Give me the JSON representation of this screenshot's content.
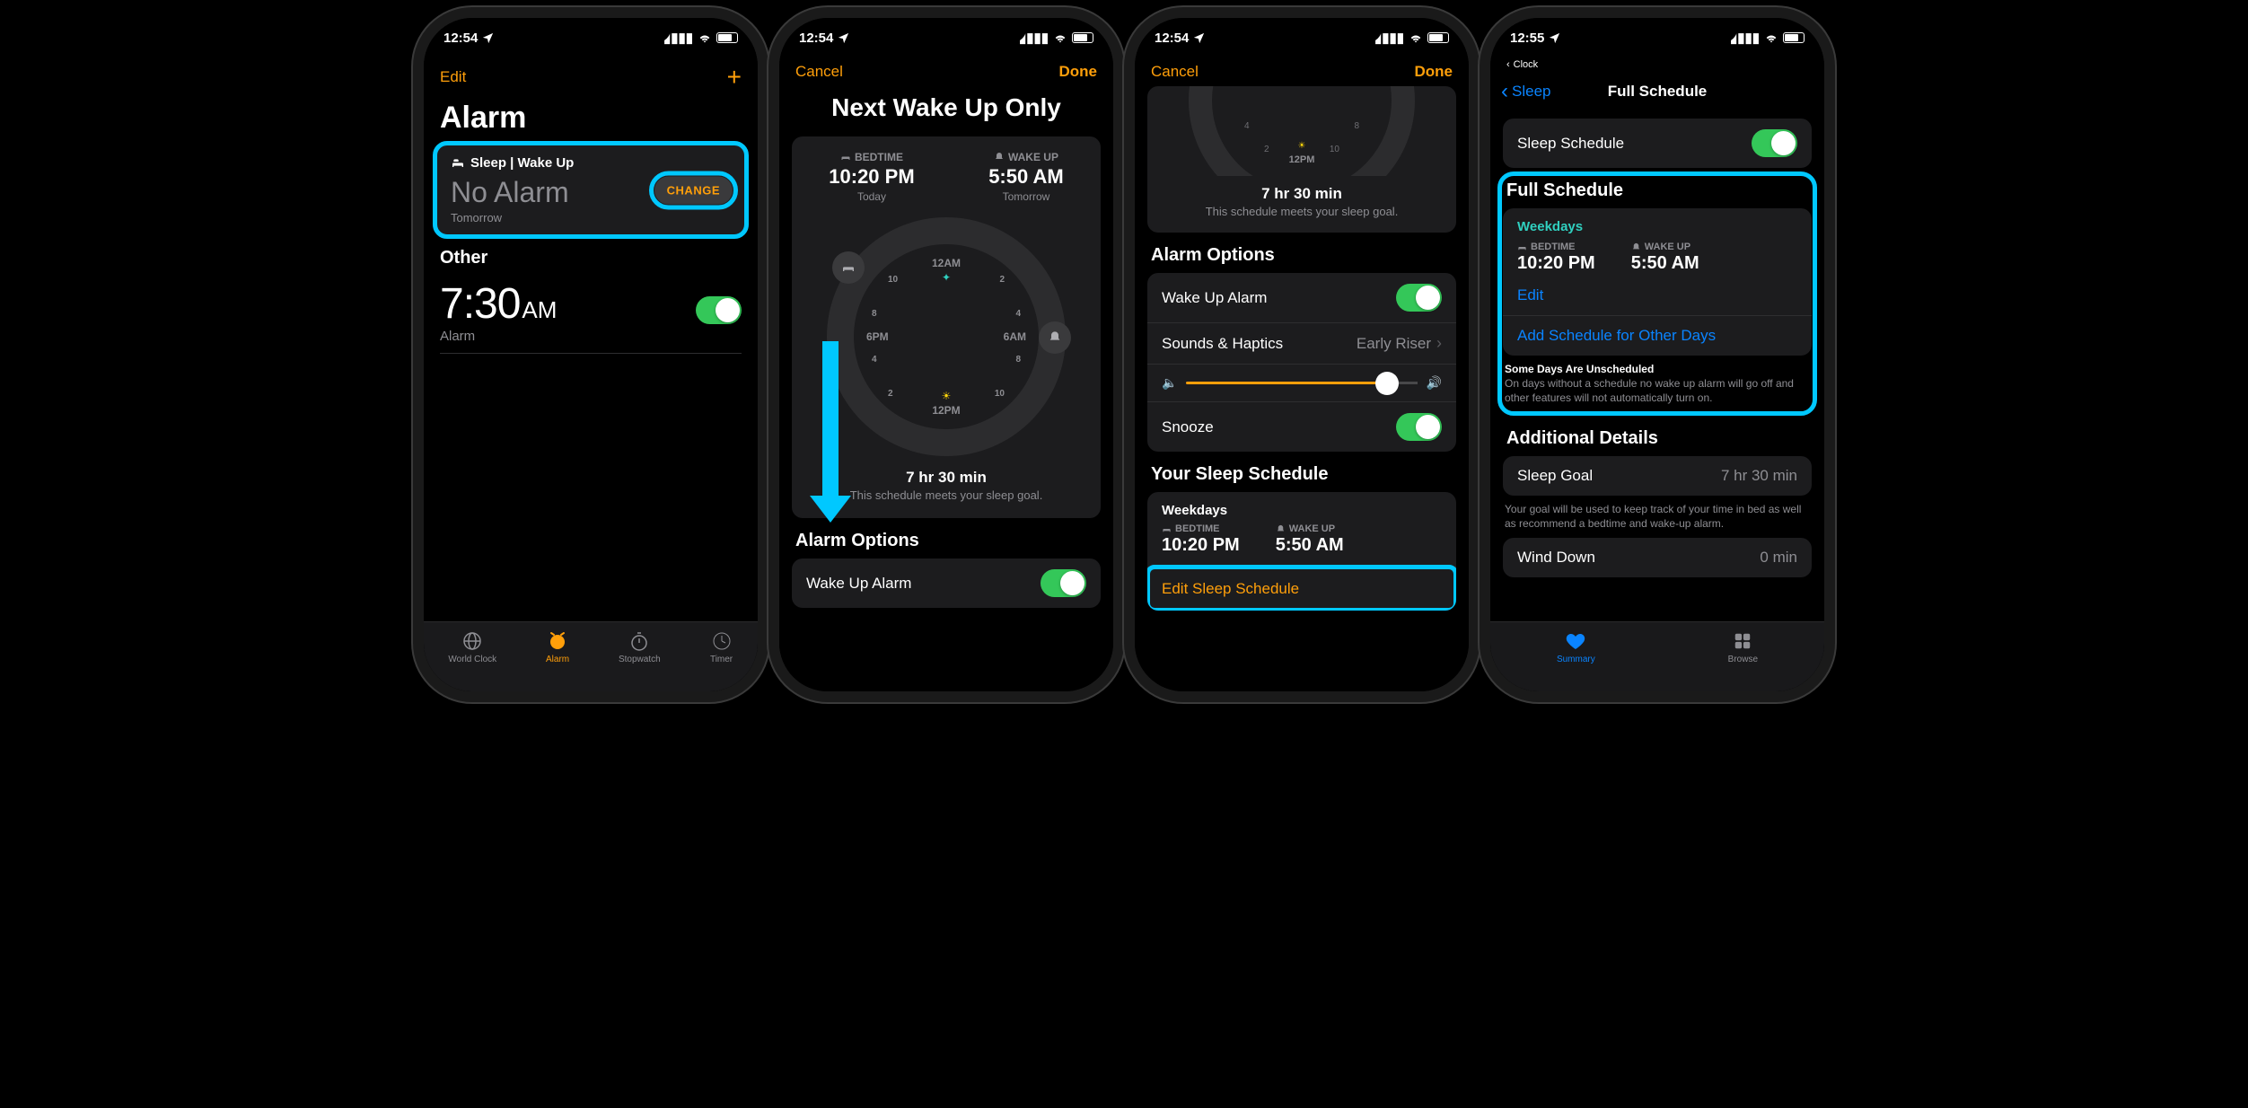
{
  "phone1": {
    "status_time": "12:54",
    "nav_edit": "Edit",
    "page_title": "Alarm",
    "sleep_section_label": "Sleep | Wake Up",
    "no_alarm": "No Alarm",
    "tomorrow": "Tomorrow",
    "change": "CHANGE",
    "other_header": "Other",
    "other_time": "7:30",
    "other_ampm": "AM",
    "other_label": "Alarm",
    "tabs": {
      "world": "World Clock",
      "alarm": "Alarm",
      "stopwatch": "Stopwatch",
      "timer": "Timer"
    }
  },
  "phone2": {
    "status_time": "12:54",
    "cancel": "Cancel",
    "done": "Done",
    "title": "Next Wake Up Only",
    "bedtime_label": "BEDTIME",
    "bedtime_value": "10:20 PM",
    "bedtime_sub": "Today",
    "wakeup_label": "WAKE UP",
    "wakeup_value": "5:50 AM",
    "wakeup_sub": "Tomorrow",
    "duration": "7 hr 30 min",
    "goal_text": "This schedule meets your sleep goal.",
    "alarm_options_header": "Alarm Options",
    "wake_up_alarm": "Wake Up Alarm",
    "dial": {
      "top": "12AM",
      "right": "6AM",
      "bottom": "12PM",
      "left": "6PM"
    }
  },
  "phone3": {
    "status_time": "12:54",
    "cancel": "Cancel",
    "done": "Done",
    "dial": {
      "bottom": "12PM"
    },
    "duration": "7 hr 30 min",
    "goal_text": "This schedule meets your sleep goal.",
    "alarm_options_header": "Alarm Options",
    "wake_up_alarm": "Wake Up Alarm",
    "sounds_haptics": "Sounds & Haptics",
    "sounds_value": "Early Riser",
    "snooze": "Snooze",
    "your_schedule_header": "Your Sleep Schedule",
    "sched_name": "Weekdays",
    "bedtime_label": "BEDTIME",
    "bedtime_value": "10:20 PM",
    "wakeup_label": "WAKE UP",
    "wakeup_value": "5:50 AM",
    "edit_schedule": "Edit Sleep Schedule"
  },
  "phone4": {
    "status_time": "12:55",
    "breadcrumb": "Clock",
    "back": "Sleep",
    "title": "Full Schedule",
    "sleep_schedule_row": "Sleep Schedule",
    "full_schedule_header": "Full Schedule",
    "sched_name": "Weekdays",
    "bedtime_label": "BEDTIME",
    "bedtime_value": "10:20 PM",
    "wakeup_label": "WAKE UP",
    "wakeup_value": "5:50 AM",
    "edit": "Edit",
    "add_schedule": "Add Schedule for Other Days",
    "unscheduled_title": "Some Days Are Unscheduled",
    "unscheduled_body": "On days without a schedule no wake up alarm will go off and other features will not automatically turn on.",
    "additional_header": "Additional Details",
    "sleep_goal_label": "Sleep Goal",
    "sleep_goal_value": "7 hr 30 min",
    "goal_footer": "Your goal will be used to keep track of your time in bed as well as recommend a bedtime and wake-up alarm.",
    "wind_down_label": "Wind Down",
    "wind_down_value": "0 min",
    "tabs": {
      "summary": "Summary",
      "browse": "Browse"
    }
  }
}
